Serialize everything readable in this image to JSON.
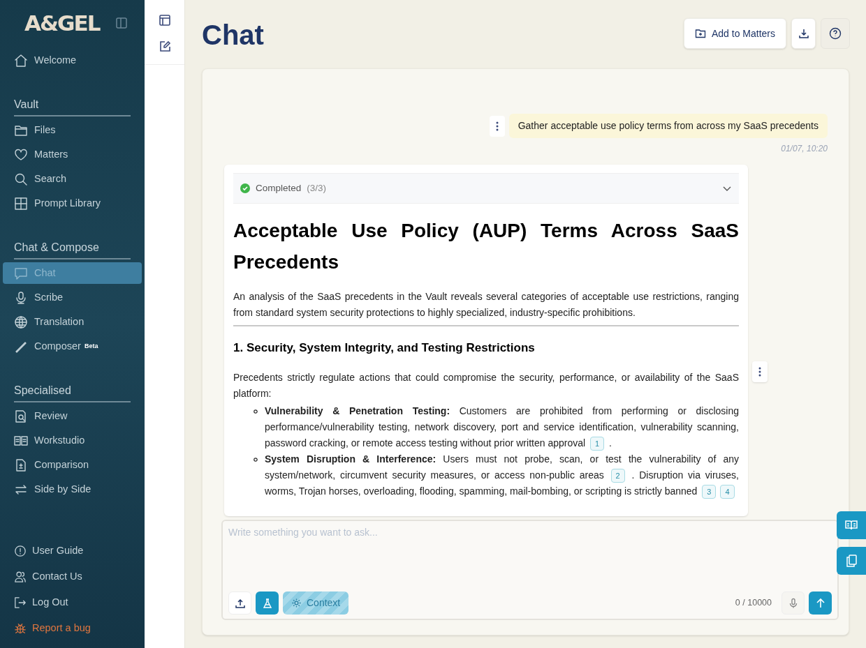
{
  "sidebar": {
    "logo": "A&GEL",
    "top_items": [
      {
        "label": "Welcome",
        "selected": false
      }
    ],
    "sections": [
      {
        "title": "Vault",
        "items": [
          {
            "label": "Files",
            "selected": false
          },
          {
            "label": "Matters",
            "selected": false
          },
          {
            "label": "Search",
            "selected": false
          },
          {
            "label": "Prompt Library",
            "selected": false
          }
        ]
      },
      {
        "title": "Chat & Compose",
        "items": [
          {
            "label": "Chat",
            "selected": true
          },
          {
            "label": "Scribe",
            "selected": false
          },
          {
            "label": "Translation",
            "selected": false
          },
          {
            "label": "Composer",
            "badge": "Beta",
            "selected": false
          }
        ]
      },
      {
        "title": "Specialised",
        "items": [
          {
            "label": "Review",
            "selected": false
          },
          {
            "label": "Workstudio",
            "selected": false
          },
          {
            "label": "Comparison",
            "selected": false
          },
          {
            "label": "Side by Side",
            "selected": false
          }
        ]
      }
    ],
    "footer_items": [
      {
        "label": "User Guide",
        "kind": "link"
      },
      {
        "label": "Contact Us",
        "kind": "link"
      },
      {
        "label": "Log Out",
        "kind": "link"
      },
      {
        "label": "Report a bug",
        "kind": "report"
      }
    ]
  },
  "page": {
    "title": "Chat",
    "actions": [
      {
        "label": "Add to Matters"
      }
    ]
  },
  "messages": [
    {
      "kind": "user",
      "text": "Gather acceptable use policy terms from across my SaaS precedents",
      "time": "01/07, 10:20"
    }
  ],
  "answer": {
    "status": {
      "label": "Completed",
      "count": "(3/3)",
      "expanded": false
    },
    "title": "Acceptable Use Policy (AUP) Terms Across SaaS Precedents",
    "intro": "An analysis of the SaaS precedents in the Vault reveals several categories of acceptable use restrictions, ranging from standard system security protections to highly specialized, industry-specific prohibitions.",
    "sections": [
      {
        "heading": "1. Security, System Integrity, and Testing Restrictions",
        "lead": "Precedents strictly regulate actions that could compromise the security, performance, or availability of the SaaS platform:",
        "bullets": [
          {
            "parts": [
              {
                "kind": "text",
                "text": "**Vulnerability & Penetration Testing:** Customers are prohibited from performing or disclosing performance/vulnerability testing, network discovery, port and service identification, vulnerability scanning, password cracking, or remote access testing without prior written approval "
              },
              {
                "kind": "cite",
                "text": "1"
              },
              {
                "kind": "text",
                "text": " ."
              }
            ]
          },
          {
            "parts": [
              {
                "kind": "text",
                "text": "**System Disruption & Interference:** Users must not probe, scan, or test the vulnerability of any system/network, circumvent security measures, or access non-public areas "
              },
              {
                "kind": "cite",
                "text": "2"
              },
              {
                "kind": "text",
                "text": " . Disruption via viruses, worms, Trojan horses, overloading, flooding, spamming, mail-bombing, or scripting is strictly banned "
              },
              {
                "kind": "cite",
                "text": "3"
              },
              {
                "kind": "cite",
                "text": "4"
              }
            ]
          }
        ]
      }
    ]
  },
  "composer": {
    "placeholder": "Write something you want to ask...",
    "context_label": "Context",
    "counter": "0 / 10000"
  }
}
